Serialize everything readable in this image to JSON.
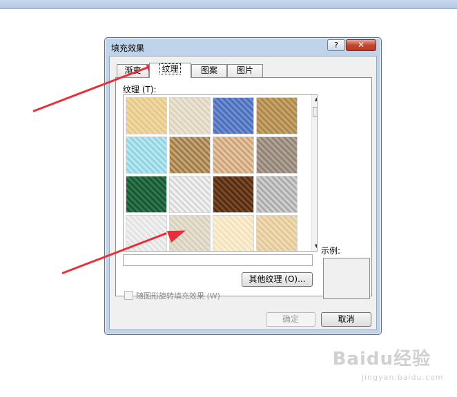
{
  "dialog": {
    "title": "填充效果",
    "help_label": "?",
    "close_label": "✕",
    "tabs": [
      {
        "label": "渐变",
        "active": false
      },
      {
        "label": "纹理",
        "active": true
      },
      {
        "label": "图案",
        "active": false
      },
      {
        "label": "图片",
        "active": false
      }
    ],
    "texture_label": "纹理 (T):",
    "texture_name_value": "",
    "other_textures_button": "其他纹理 (O)...",
    "rotate_checkbox_label": "随图形旋转填充效果 (W)",
    "rotate_checkbox_checked": false,
    "rotate_checkbox_enabled": false,
    "sample_label": "示例:",
    "ok_button": "确定",
    "ok_enabled": false,
    "cancel_button": "取消",
    "scroll_up_icon": "▲",
    "scroll_down_icon": "▼"
  },
  "textures": [
    {
      "name": "papyrus",
      "colors": [
        "#f0d9a2",
        "#e5c78a"
      ]
    },
    {
      "name": "canvas",
      "colors": [
        "#ebe4d4",
        "#dcd1bb"
      ]
    },
    {
      "name": "denim",
      "colors": [
        "#6f8fd4",
        "#4b6db8"
      ]
    },
    {
      "name": "woven-mat",
      "colors": [
        "#c9a467",
        "#a9854f"
      ]
    },
    {
      "name": "water-droplets",
      "colors": [
        "#b9e7f0",
        "#8fd2e2"
      ]
    },
    {
      "name": "paper-bag",
      "colors": [
        "#c6a473",
        "#9c7a4a"
      ]
    },
    {
      "name": "fish-fossil",
      "colors": [
        "#e6c6a0",
        "#c9a27a"
      ]
    },
    {
      "name": "sand",
      "colors": [
        "#b0a396",
        "#8f8275"
      ]
    },
    {
      "name": "green-marble",
      "colors": [
        "#2f7a4c",
        "#1b5434"
      ]
    },
    {
      "name": "white-marble",
      "colors": [
        "#f2f2f2",
        "#d6d6d6"
      ]
    },
    {
      "name": "brown-marble",
      "colors": [
        "#7a4b26",
        "#4f2c13"
      ]
    },
    {
      "name": "granite",
      "colors": [
        "#cfcfcf",
        "#a9a9a9"
      ]
    },
    {
      "name": "newsprint",
      "colors": [
        "#f1f1f1",
        "#e1e1e1"
      ]
    },
    {
      "name": "recycled-paper",
      "colors": [
        "#e7e1d1",
        "#d6cfbc"
      ]
    },
    {
      "name": "parchment",
      "colors": [
        "#fbf0d5",
        "#f3e1ba"
      ]
    },
    {
      "name": "stationery",
      "colors": [
        "#f0dcb4",
        "#e1c796"
      ]
    }
  ],
  "annotations": {
    "arrow_color": "#e8303a"
  },
  "watermark": {
    "logo": "Baidu经验",
    "url": "jingyan.baidu.com"
  }
}
